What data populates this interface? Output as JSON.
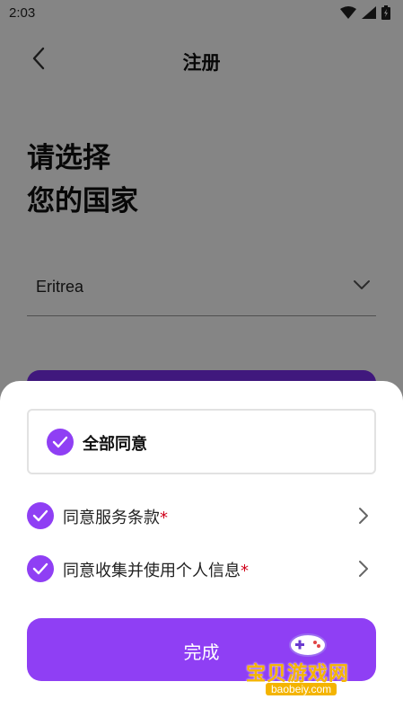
{
  "status_bar": {
    "time": "2:03"
  },
  "header": {
    "title": "注册"
  },
  "heading": {
    "line1": "请选择",
    "line2": "您的国家"
  },
  "country_select": {
    "value": "Eritrea"
  },
  "sheet": {
    "agree_all": {
      "label": "全部同意",
      "checked": true
    },
    "terms": [
      {
        "label": "同意服务条款",
        "required_mark": "*",
        "checked": true
      },
      {
        "label": "同意收集并使用个人信息",
        "required_mark": "*",
        "checked": true
      }
    ],
    "done_label": "完成"
  },
  "watermark": {
    "title": "宝贝游戏网",
    "url": "baobeiy.com"
  },
  "colors": {
    "accent": "#8f3ff4",
    "accent_dark": "#7b2ff0",
    "required": "#d0021b"
  }
}
